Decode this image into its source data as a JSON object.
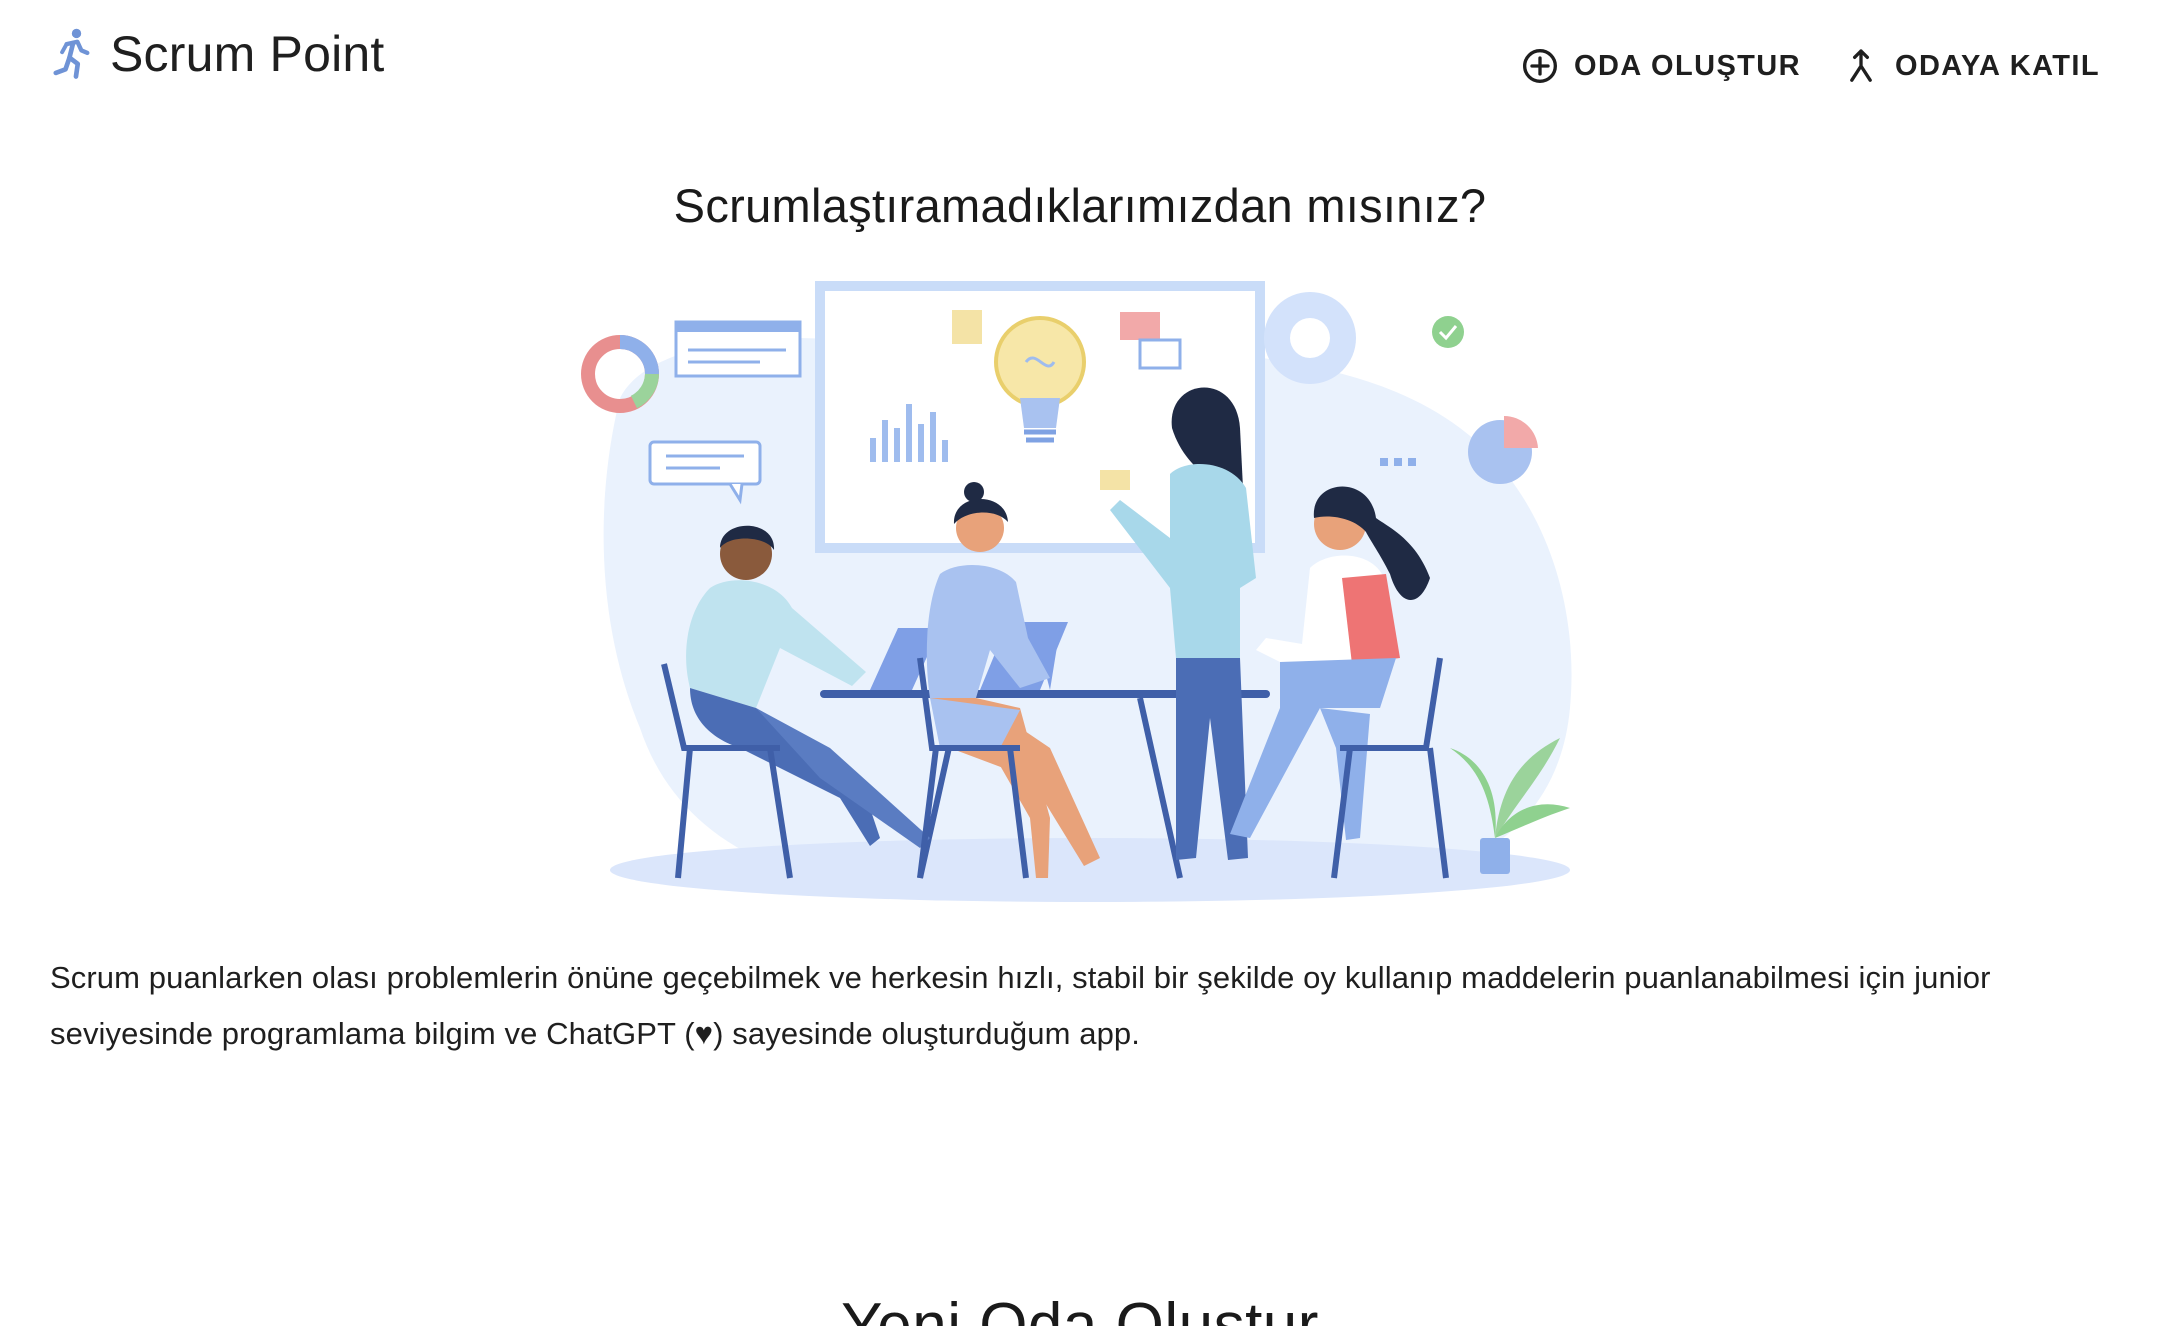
{
  "header": {
    "brand_title": "Scrum Point",
    "brand_icon": "running-person-icon",
    "nav": {
      "create_room_label": "ODA OLUŞTUR",
      "create_room_icon": "add-circle-icon",
      "join_room_label": "ODAYA KATIL",
      "join_room_icon": "merge-arrow-icon"
    }
  },
  "hero": {
    "title": "Scrumlaştıramadıklarımızdan mısınız?",
    "illustration": "team-meeting-illustration"
  },
  "description": "Scrum puanlarken olası problemlerin önüne geçebilmek ve herkesin hızlı, stabil bir şekilde oy kullanıp maddelerin puanlanabilmesi için junior seviyesinde programlama bilgim ve ChatGPT (♥) sayesinde oluşturduğum app.",
  "section": {
    "title": "Yeni Oda Oluştur"
  },
  "colors": {
    "brand_icon": "#6f93d6",
    "text": "#1f1f1f",
    "background": "#ffffff"
  }
}
